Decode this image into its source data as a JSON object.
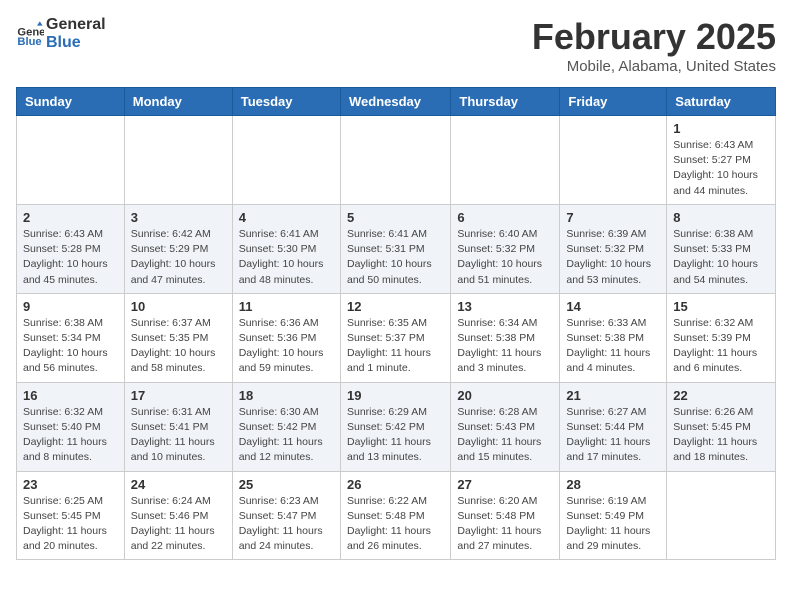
{
  "header": {
    "logo_line1": "General",
    "logo_line2": "Blue",
    "month": "February 2025",
    "location": "Mobile, Alabama, United States"
  },
  "weekdays": [
    "Sunday",
    "Monday",
    "Tuesday",
    "Wednesday",
    "Thursday",
    "Friday",
    "Saturday"
  ],
  "weeks": [
    [
      {
        "day": "",
        "info": ""
      },
      {
        "day": "",
        "info": ""
      },
      {
        "day": "",
        "info": ""
      },
      {
        "day": "",
        "info": ""
      },
      {
        "day": "",
        "info": ""
      },
      {
        "day": "",
        "info": ""
      },
      {
        "day": "1",
        "info": "Sunrise: 6:43 AM\nSunset: 5:27 PM\nDaylight: 10 hours\nand 44 minutes."
      }
    ],
    [
      {
        "day": "2",
        "info": "Sunrise: 6:43 AM\nSunset: 5:28 PM\nDaylight: 10 hours\nand 45 minutes."
      },
      {
        "day": "3",
        "info": "Sunrise: 6:42 AM\nSunset: 5:29 PM\nDaylight: 10 hours\nand 47 minutes."
      },
      {
        "day": "4",
        "info": "Sunrise: 6:41 AM\nSunset: 5:30 PM\nDaylight: 10 hours\nand 48 minutes."
      },
      {
        "day": "5",
        "info": "Sunrise: 6:41 AM\nSunset: 5:31 PM\nDaylight: 10 hours\nand 50 minutes."
      },
      {
        "day": "6",
        "info": "Sunrise: 6:40 AM\nSunset: 5:32 PM\nDaylight: 10 hours\nand 51 minutes."
      },
      {
        "day": "7",
        "info": "Sunrise: 6:39 AM\nSunset: 5:32 PM\nDaylight: 10 hours\nand 53 minutes."
      },
      {
        "day": "8",
        "info": "Sunrise: 6:38 AM\nSunset: 5:33 PM\nDaylight: 10 hours\nand 54 minutes."
      }
    ],
    [
      {
        "day": "9",
        "info": "Sunrise: 6:38 AM\nSunset: 5:34 PM\nDaylight: 10 hours\nand 56 minutes."
      },
      {
        "day": "10",
        "info": "Sunrise: 6:37 AM\nSunset: 5:35 PM\nDaylight: 10 hours\nand 58 minutes."
      },
      {
        "day": "11",
        "info": "Sunrise: 6:36 AM\nSunset: 5:36 PM\nDaylight: 10 hours\nand 59 minutes."
      },
      {
        "day": "12",
        "info": "Sunrise: 6:35 AM\nSunset: 5:37 PM\nDaylight: 11 hours\nand 1 minute."
      },
      {
        "day": "13",
        "info": "Sunrise: 6:34 AM\nSunset: 5:38 PM\nDaylight: 11 hours\nand 3 minutes."
      },
      {
        "day": "14",
        "info": "Sunrise: 6:33 AM\nSunset: 5:38 PM\nDaylight: 11 hours\nand 4 minutes."
      },
      {
        "day": "15",
        "info": "Sunrise: 6:32 AM\nSunset: 5:39 PM\nDaylight: 11 hours\nand 6 minutes."
      }
    ],
    [
      {
        "day": "16",
        "info": "Sunrise: 6:32 AM\nSunset: 5:40 PM\nDaylight: 11 hours\nand 8 minutes."
      },
      {
        "day": "17",
        "info": "Sunrise: 6:31 AM\nSunset: 5:41 PM\nDaylight: 11 hours\nand 10 minutes."
      },
      {
        "day": "18",
        "info": "Sunrise: 6:30 AM\nSunset: 5:42 PM\nDaylight: 11 hours\nand 12 minutes."
      },
      {
        "day": "19",
        "info": "Sunrise: 6:29 AM\nSunset: 5:42 PM\nDaylight: 11 hours\nand 13 minutes."
      },
      {
        "day": "20",
        "info": "Sunrise: 6:28 AM\nSunset: 5:43 PM\nDaylight: 11 hours\nand 15 minutes."
      },
      {
        "day": "21",
        "info": "Sunrise: 6:27 AM\nSunset: 5:44 PM\nDaylight: 11 hours\nand 17 minutes."
      },
      {
        "day": "22",
        "info": "Sunrise: 6:26 AM\nSunset: 5:45 PM\nDaylight: 11 hours\nand 18 minutes."
      }
    ],
    [
      {
        "day": "23",
        "info": "Sunrise: 6:25 AM\nSunset: 5:45 PM\nDaylight: 11 hours\nand 20 minutes."
      },
      {
        "day": "24",
        "info": "Sunrise: 6:24 AM\nSunset: 5:46 PM\nDaylight: 11 hours\nand 22 minutes."
      },
      {
        "day": "25",
        "info": "Sunrise: 6:23 AM\nSunset: 5:47 PM\nDaylight: 11 hours\nand 24 minutes."
      },
      {
        "day": "26",
        "info": "Sunrise: 6:22 AM\nSunset: 5:48 PM\nDaylight: 11 hours\nand 26 minutes."
      },
      {
        "day": "27",
        "info": "Sunrise: 6:20 AM\nSunset: 5:48 PM\nDaylight: 11 hours\nand 27 minutes."
      },
      {
        "day": "28",
        "info": "Sunrise: 6:19 AM\nSunset: 5:49 PM\nDaylight: 11 hours\nand 29 minutes."
      },
      {
        "day": "",
        "info": ""
      }
    ]
  ]
}
